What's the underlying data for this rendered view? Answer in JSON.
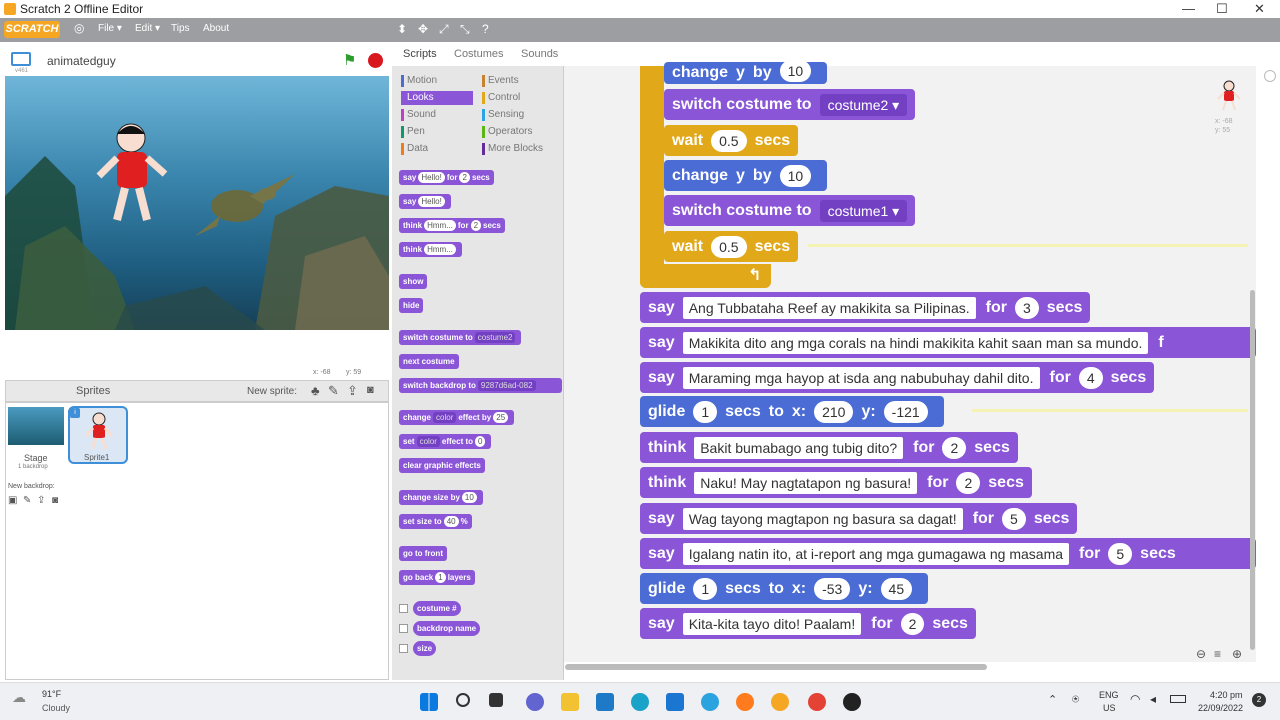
{
  "window": {
    "title": "Scratch 2 Offline Editor",
    "min": "—",
    "max": "☐",
    "close": "✕"
  },
  "menubar": {
    "logo": "SCRATCH",
    "file": "File ▾",
    "edit": "Edit ▾",
    "tips": "Tips",
    "about": "About"
  },
  "stage": {
    "project_name": "animatedguy",
    "version": "v461",
    "mouse_x": "x: -68",
    "mouse_y": "y: 59"
  },
  "sprites_panel": {
    "title": "Sprites",
    "new_sprite": "New sprite:",
    "stage_label": "Stage",
    "stage_backdrops": "1 backdrop",
    "new_backdrop": "New backdrop:",
    "sprite_name": "Sprite1"
  },
  "tabs": {
    "scripts": "Scripts",
    "costumes": "Costumes",
    "sounds": "Sounds"
  },
  "categories": {
    "motion": "Motion",
    "looks": "Looks",
    "sound": "Sound",
    "pen": "Pen",
    "data": "Data",
    "events": "Events",
    "control": "Control",
    "sensing": "Sensing",
    "operators": "Operators",
    "more": "More Blocks"
  },
  "palette": {
    "say_for": {
      "w1": "say",
      "v1": "Hello!",
      "w2": "for",
      "v2": "2",
      "w3": "secs"
    },
    "say": {
      "w1": "say",
      "v1": "Hello!"
    },
    "think_for": {
      "w1": "think",
      "v1": "Hmm...",
      "w2": "for",
      "v2": "2",
      "w3": "secs"
    },
    "think": {
      "w1": "think",
      "v1": "Hmm..."
    },
    "show": "show",
    "hide": "hide",
    "switch_costume": {
      "w1": "switch costume to",
      "v1": "costume2"
    },
    "next_costume": "next costume",
    "switch_backdrop": {
      "w1": "switch backdrop to",
      "v1": "9287d6ad-082"
    },
    "change_effect": {
      "w1": "change",
      "v1": "color",
      "w2": "effect by",
      "v2": "25"
    },
    "set_effect": {
      "w1": "set",
      "v1": "color",
      "w2": "effect to",
      "v2": "0"
    },
    "clear_effects": "clear graphic effects",
    "change_size": {
      "w1": "change size by",
      "v1": "10"
    },
    "set_size": {
      "w1": "set size to",
      "v1": "40",
      "w2": "%"
    },
    "go_front": "go to front",
    "go_back": {
      "w1": "go back",
      "v1": "1",
      "w2": "layers"
    },
    "rep_costume": "costume #",
    "rep_backdrop": "backdrop name",
    "rep_size": "size"
  },
  "script": {
    "b0": {
      "w1": "change",
      "w2": "y",
      "w3": "by",
      "v1": "10"
    },
    "b1": {
      "w1": "switch costume to",
      "v1": "costume2"
    },
    "b2": {
      "w1": "wait",
      "v1": "0.5",
      "w2": "secs"
    },
    "b3": {
      "w1": "change",
      "w2": "y",
      "w3": "by",
      "v1": "10"
    },
    "b4": {
      "w1": "switch costume to",
      "v1": "costume1"
    },
    "b5": {
      "w1": "wait",
      "v1": "0.5",
      "w2": "secs"
    },
    "s1": {
      "w1": "say",
      "t": "Ang Tubbataha Reef ay makikita sa Pilipinas.",
      "w2": "for",
      "n": "3",
      "w3": "secs"
    },
    "s2": {
      "w1": "say",
      "t": "Makikita dito ang mga corals na hindi makikita kahit saan man sa mundo.",
      "w2": "f"
    },
    "s3": {
      "w1": "say",
      "t": "Maraming mga hayop at isda ang nabubuhay dahil dito.",
      "w2": "for",
      "n": "4",
      "w3": "secs"
    },
    "g1": {
      "w1": "glide",
      "n1": "1",
      "w2": "secs",
      "w3": "to",
      "w4": "x:",
      "n2": "210",
      "w5": "y:",
      "n3": "-121"
    },
    "t1": {
      "w1": "think",
      "t": "Bakit bumabago ang tubig dito?",
      "w2": "for",
      "n": "2",
      "w3": "secs"
    },
    "t2": {
      "w1": "think",
      "t": "Naku! May nagtatapon ng basura!",
      "w2": "for",
      "n": "2",
      "w3": "secs"
    },
    "s4": {
      "w1": "say",
      "t": "Wag tayong magtapon ng basura sa dagat!",
      "w2": "for",
      "n": "5",
      "w3": "secs"
    },
    "s5": {
      "w1": "say",
      "t": "Igalang natin ito, at i-report ang mga gumagawa ng masama",
      "w2": "for",
      "n": "5",
      "w3": "secs"
    },
    "g2": {
      "w1": "glide",
      "n1": "1",
      "w2": "secs",
      "w3": "to",
      "w4": "x:",
      "n2": "-53",
      "w5": "y:",
      "n3": "45"
    },
    "s6": {
      "w1": "say",
      "t": "Kita-kita tayo dito! Paalam!",
      "w2": "for",
      "n": "2",
      "w3": "secs"
    }
  },
  "sprite_info": {
    "x": "x: -68",
    "y": "y: 55"
  },
  "taskbar": {
    "weather_temp": "91°F",
    "weather_desc": "Cloudy",
    "lang": "ENG",
    "region": "US",
    "time": "4:20 pm",
    "date": "22/09/2022"
  },
  "colors": {
    "looks": "#8a55d7",
    "motion": "#4a6cd4",
    "control": "#e1a91a",
    "menubar": "#9c9ea2"
  }
}
